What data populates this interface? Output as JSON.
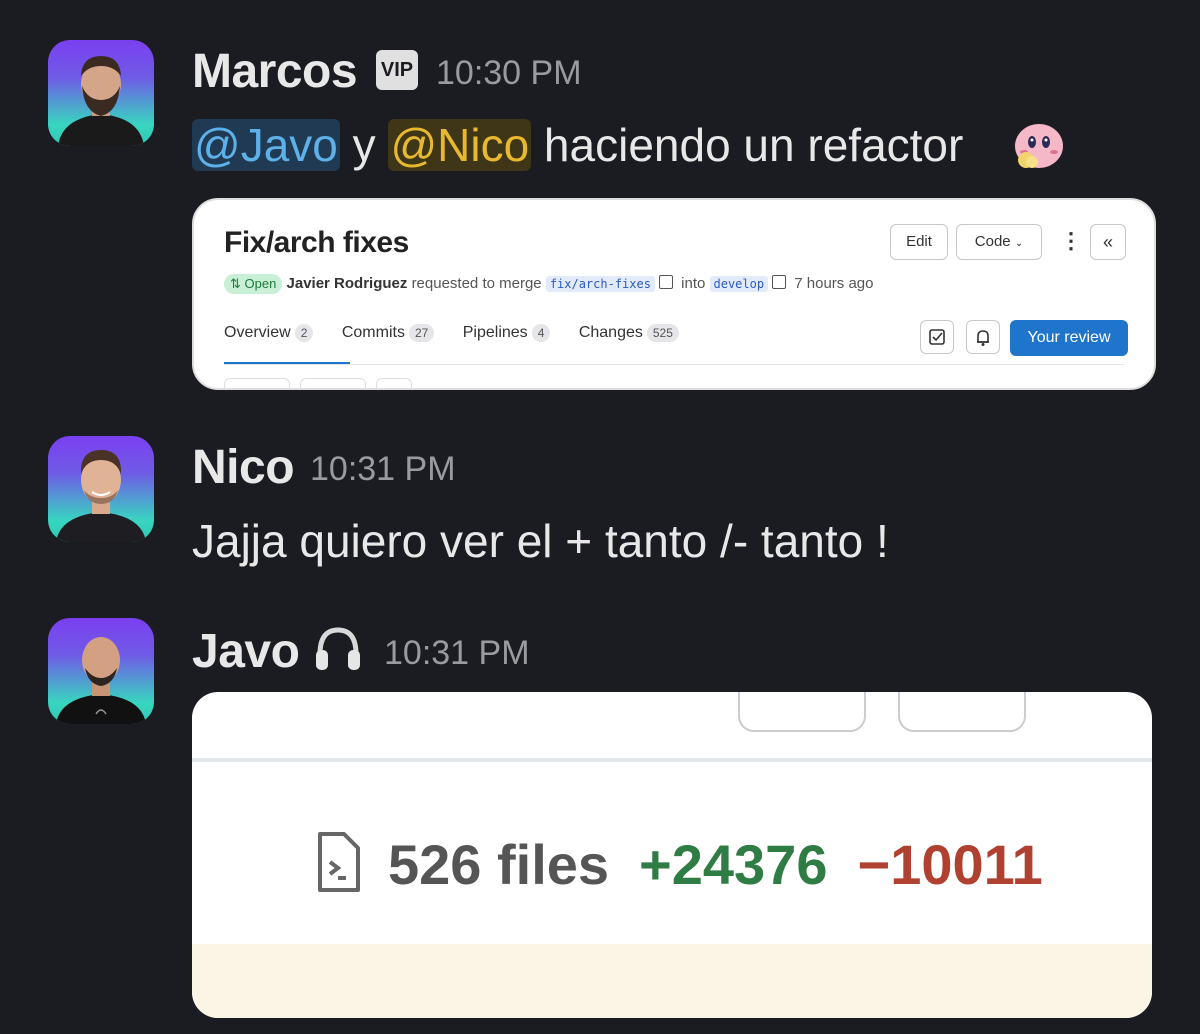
{
  "messages": [
    {
      "author": "Marcos",
      "badge": "VIP",
      "time": "10:30 PM",
      "text_parts": {
        "mention1": "@Javo",
        "connector": " y ",
        "mention2": "@Nico",
        "rest": " haciendo un refactor"
      },
      "emoji": "kirby-blush-emoji",
      "attachment": {
        "title": "Fix/arch fixes",
        "edit_label": "Edit",
        "code_label": "Code",
        "status": "Open",
        "author": "Javier Rodriguez",
        "requested_text": "requested to merge",
        "source_branch": "fix/arch-fixes",
        "into_text": "into",
        "target_branch": "develop",
        "age": "7 hours ago",
        "tabs": [
          {
            "label": "Overview",
            "count": "2"
          },
          {
            "label": "Commits",
            "count": "27"
          },
          {
            "label": "Pipelines",
            "count": "4"
          },
          {
            "label": "Changes",
            "count": "525"
          }
        ],
        "review_label": "Your review"
      }
    },
    {
      "author": "Nico",
      "time": "10:31 PM",
      "text": "Jajja quiero ver el + tanto /- tanto !"
    },
    {
      "author": "Javo",
      "status_icon": "headphones-icon",
      "time": "10:31 PM",
      "attachment": {
        "files": "526 files",
        "additions": "+24376",
        "deletions": "−10011"
      }
    }
  ],
  "colors": {
    "background": "#1b1c21",
    "mention_javo": "#5eb0e8",
    "mention_nico": "#e8b830",
    "additions": "#2f7d45",
    "deletions": "#b0402f",
    "primary_button": "#1f75cb"
  }
}
